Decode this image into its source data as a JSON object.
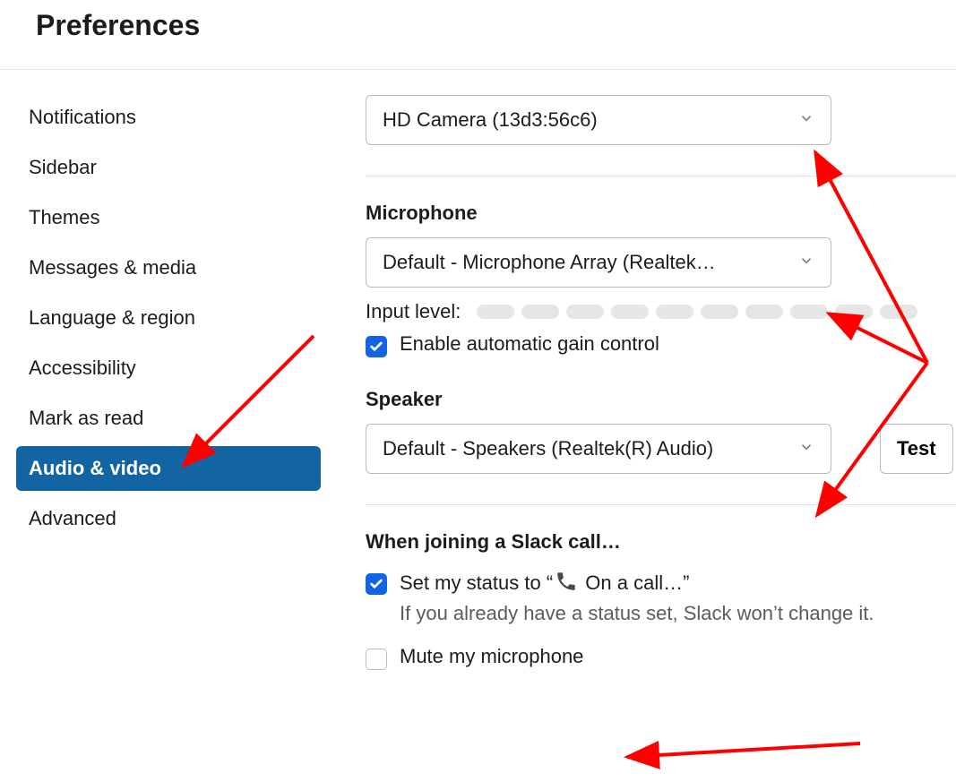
{
  "header": {
    "title": "Preferences"
  },
  "sidebar": {
    "items": [
      {
        "label": "Notifications",
        "active": false
      },
      {
        "label": "Sidebar",
        "active": false
      },
      {
        "label": "Themes",
        "active": false
      },
      {
        "label": "Messages & media",
        "active": false
      },
      {
        "label": "Language & region",
        "active": false
      },
      {
        "label": "Accessibility",
        "active": false
      },
      {
        "label": "Mark as read",
        "active": false
      },
      {
        "label": "Audio & video",
        "active": true
      },
      {
        "label": "Advanced",
        "active": false
      }
    ]
  },
  "main": {
    "camera": {
      "selected": "HD Camera (13d3:56c6)"
    },
    "microphone": {
      "heading": "Microphone",
      "selected": "Default - Microphone Array (Realtek…",
      "inputLevelLabel": "Input level:",
      "gainControl": {
        "checked": true,
        "label": "Enable automatic gain control"
      }
    },
    "speaker": {
      "heading": "Speaker",
      "selected": "Default - Speakers (Realtek(R) Audio)",
      "testLabel": "Test"
    },
    "call": {
      "heading": "When joining a Slack call…",
      "setStatus": {
        "checked": true,
        "prefix": "Set my status to “",
        "statusText": "On a call…",
        "suffix": "”",
        "subtext": "If you already have a status set, Slack won’t change it."
      },
      "muteMic": {
        "checked": false,
        "label": "Mute my microphone"
      }
    }
  },
  "colors": {
    "accent": "#1264a3",
    "checkbox": "#1264e3",
    "arrow": "#ff0000"
  }
}
